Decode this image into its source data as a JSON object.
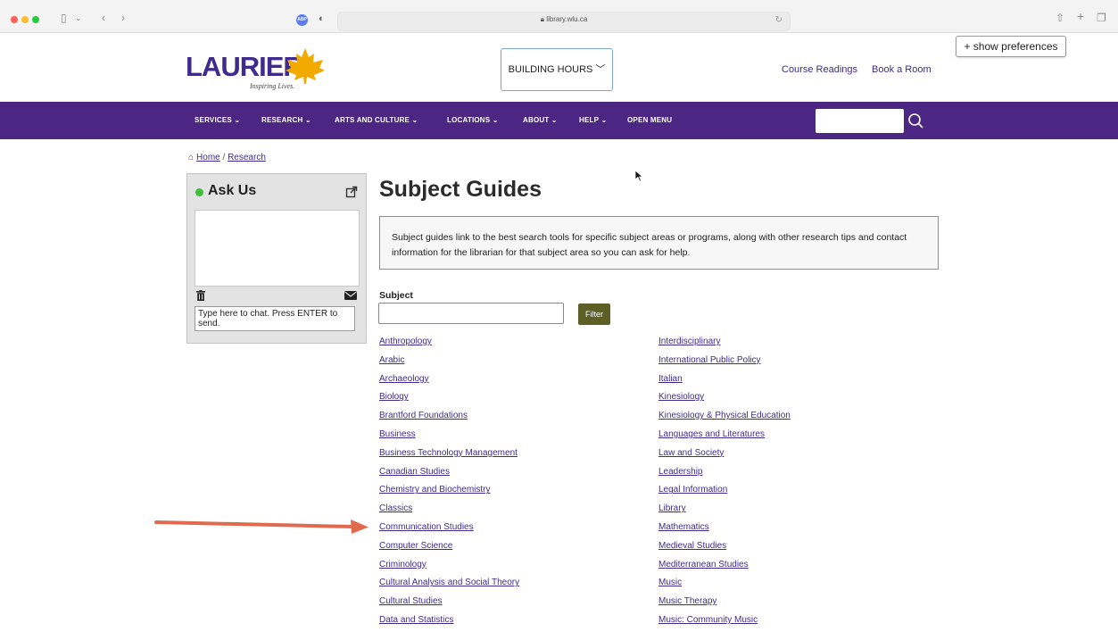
{
  "browser": {
    "url": "library.wlu.ca"
  },
  "preferences_button": "+ show preferences",
  "header": {
    "logo_text": "LAURIER",
    "logo_tagline": "Inspiring Lives.",
    "building_hours": "BUILDING HOURS",
    "links": [
      "Course Readings",
      "Book a Room"
    ]
  },
  "nav": {
    "items": [
      "SERVICES",
      "RESEARCH",
      "ARTS AND CULTURE",
      "LOCATIONS",
      "ABOUT",
      "HELP",
      "OPEN MENU"
    ],
    "chevron": "⌄"
  },
  "breadcrumb": {
    "home": "Home",
    "separator": "/",
    "current": "Research"
  },
  "askus": {
    "title": "Ask Us",
    "input_placeholder": "Type here to chat. Press ENTER to send.",
    "status_color": "#3cc13b"
  },
  "main": {
    "title": "Subject Guides",
    "intro": "Subject guides link to the best search tools for specific subject areas or programs, along with other research tips and contact information for the librarian for that subject area so you can ask for help.",
    "subject_label": "Subject",
    "filter_label": "Filter",
    "subjects_left": [
      "Anthropology",
      "Arabic",
      "Archaeology",
      "Biology",
      "Brantford Foundations",
      "Business",
      "Business Technology Management",
      "Canadian Studies",
      "Chemistry and Biochemistry",
      "Classics",
      "Communication Studies",
      "Computer Science",
      "Criminology",
      "Cultural Analysis and Social Theory",
      "Cultural Studies",
      "Data and Statistics"
    ],
    "subjects_right": [
      "Interdisciplinary",
      "International Public Policy",
      "Italian",
      "Kinesiology",
      "Kinesiology & Physical Education",
      "Languages and Literatures",
      "Law and Society",
      "Leadership",
      "Legal Information",
      "Library",
      "Mathematics",
      "Medieval Studies",
      "Mediterranean Studies",
      "Music",
      "Music Therapy",
      "Music: Community Music"
    ]
  },
  "colors": {
    "brand_purple": "#4b2682",
    "link": "#3e2b8b",
    "filter_button": "#5d5f25",
    "annotation_arrow": "#e06a4e"
  }
}
